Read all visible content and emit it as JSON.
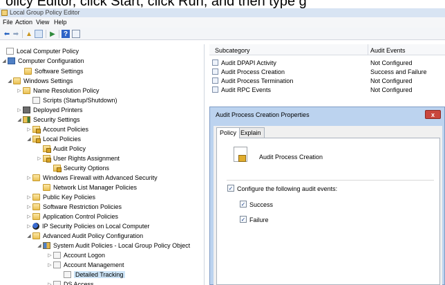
{
  "caption": "olicy Editor, click Start, click Run, and then type g",
  "window": {
    "title": "Local Group Policy Editor"
  },
  "menu": [
    "File",
    "Action",
    "View",
    "Help"
  ],
  "toolbar": [
    "back-arrow-icon",
    "forward-arrow-icon",
    "up-folder-icon",
    "show-hide-tree-icon",
    "export-list-icon",
    "help-icon",
    "properties-icon"
  ],
  "tree": [
    {
      "label": "Local Computer Policy",
      "arrow": "",
      "icon": "doc"
    },
    {
      "label": "Computer Configuration",
      "arrow": "◢",
      "icon": "computer"
    },
    {
      "label": "Software Settings",
      "arrow": "",
      "icon": "folder"
    },
    {
      "label": "Windows Settings",
      "arrow": "◢",
      "icon": "folder"
    },
    {
      "label": "Name Resolution Policy",
      "arrow": "▷",
      "icon": "folder"
    },
    {
      "label": "Scripts (Startup/Shutdown)",
      "arrow": "",
      "icon": "script"
    },
    {
      "label": "Deployed Printers",
      "arrow": "▷",
      "icon": "printer"
    },
    {
      "label": "Security Settings",
      "arrow": "◢",
      "icon": "secfolder"
    },
    {
      "label": "Account Policies",
      "arrow": "▷",
      "icon": "lockfolder"
    },
    {
      "label": "Local Policies",
      "arrow": "◢",
      "icon": "lockfolder"
    },
    {
      "label": "Audit Policy",
      "arrow": "",
      "icon": "lockfolder"
    },
    {
      "label": "User Rights Assignment",
      "arrow": "▷",
      "icon": "lockfolder"
    },
    {
      "label": "Security Options",
      "arrow": "",
      "icon": "lockfolder"
    },
    {
      "label": "Windows Firewall with Advanced Security",
      "arrow": "▷",
      "icon": "folder"
    },
    {
      "label": "Network List Manager Policies",
      "arrow": "",
      "icon": "folder"
    },
    {
      "label": "Public Key Policies",
      "arrow": "▷",
      "icon": "folder"
    },
    {
      "label": "Software Restriction Policies",
      "arrow": "▷",
      "icon": "folder"
    },
    {
      "label": "Application Control Policies",
      "arrow": "▷",
      "icon": "folder"
    },
    {
      "label": "IP Security Policies on Local Computer",
      "arrow": "▷",
      "icon": "ipsec"
    },
    {
      "label": "Advanced Audit Policy Configuration",
      "arrow": "◢",
      "icon": "folder"
    },
    {
      "label": "System Audit Policies - Local Group Policy Object",
      "arrow": "◢",
      "icon": "gpobj"
    },
    {
      "label": "Account Logon",
      "arrow": "▷",
      "icon": "page"
    },
    {
      "label": "Account Management",
      "arrow": "▷",
      "icon": "page"
    },
    {
      "label": "Detailed Tracking",
      "arrow": "",
      "icon": "page",
      "selected": true
    },
    {
      "label": "DS Access",
      "arrow": "▷",
      "icon": "page"
    }
  ],
  "list": {
    "headers": [
      "Subcategory",
      "Audit Events"
    ],
    "rows": [
      {
        "subcategory": "Audit DPAPI Activity",
        "events": "Not Configured"
      },
      {
        "subcategory": "Audit Process Creation",
        "events": "Success and Failure"
      },
      {
        "subcategory": "Audit Process Termination",
        "events": "Not Configured"
      },
      {
        "subcategory": "Audit RPC Events",
        "events": "Not Configured"
      }
    ]
  },
  "dialog": {
    "title": "Audit Process Creation Properties",
    "close": "x",
    "tabs": [
      "Policy",
      "Explain"
    ],
    "policy_name": "Audit Process Creation",
    "configure_label": "Configure the following audit events:",
    "configure_checked": true,
    "success_label": "Success",
    "success_checked": true,
    "failure_label": "Failure",
    "failure_checked": true
  }
}
